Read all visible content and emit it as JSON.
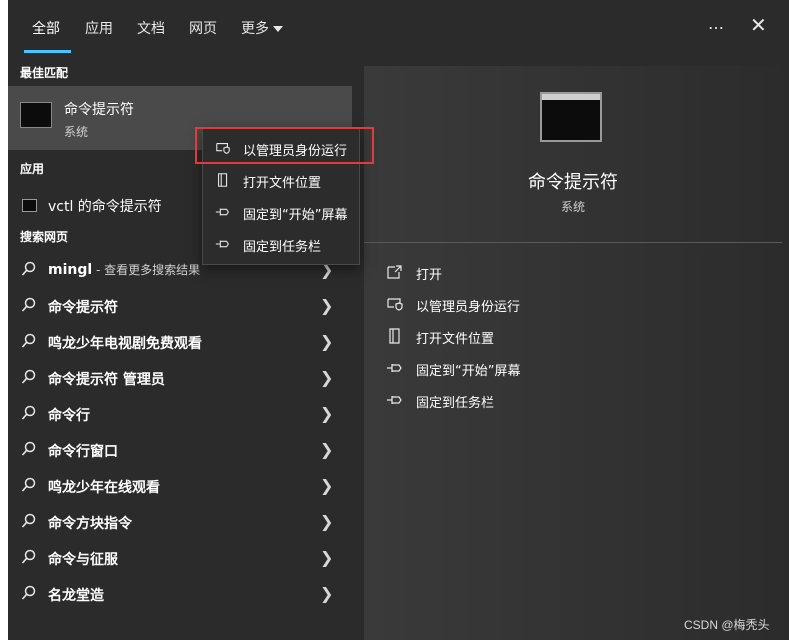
{
  "tabs": [
    "全部",
    "应用",
    "文档",
    "网页",
    "更多"
  ],
  "header": {
    "more_icon": "…",
    "close_icon": "✕"
  },
  "left": {
    "best_match_title": "最佳匹配",
    "best": {
      "title": "命令提示符",
      "sub": "系统"
    },
    "apps_title": "应用",
    "app_item": "vctl 的命令提示符",
    "web_title": "搜索网页",
    "web_items": [
      {
        "label": "mingl",
        "hint": " - 查看更多搜索结果"
      },
      {
        "label": "命令提示符",
        "hint": ""
      },
      {
        "label": "鸣龙少年电视剧免费观看",
        "hint": ""
      },
      {
        "label": "命令提示符 管理员",
        "hint": ""
      },
      {
        "label": "命令行",
        "hint": ""
      },
      {
        "label": "命令行窗口",
        "hint": ""
      },
      {
        "label": "鸣龙少年在线观看",
        "hint": ""
      },
      {
        "label": "命令方块指令",
        "hint": ""
      },
      {
        "label": "命令与征服",
        "hint": ""
      },
      {
        "label": "名龙堂造",
        "hint": ""
      }
    ]
  },
  "context_menu": [
    "以管理员身份运行",
    "打开文件位置",
    "固定到“开始”屏幕",
    "固定到任务栏"
  ],
  "right": {
    "title": "命令提示符",
    "sub": "系统",
    "actions": [
      "打开",
      "以管理员身份运行",
      "打开文件位置",
      "固定到“开始”屏幕",
      "固定到任务栏"
    ]
  },
  "watermark": "CSDN @梅秃头"
}
